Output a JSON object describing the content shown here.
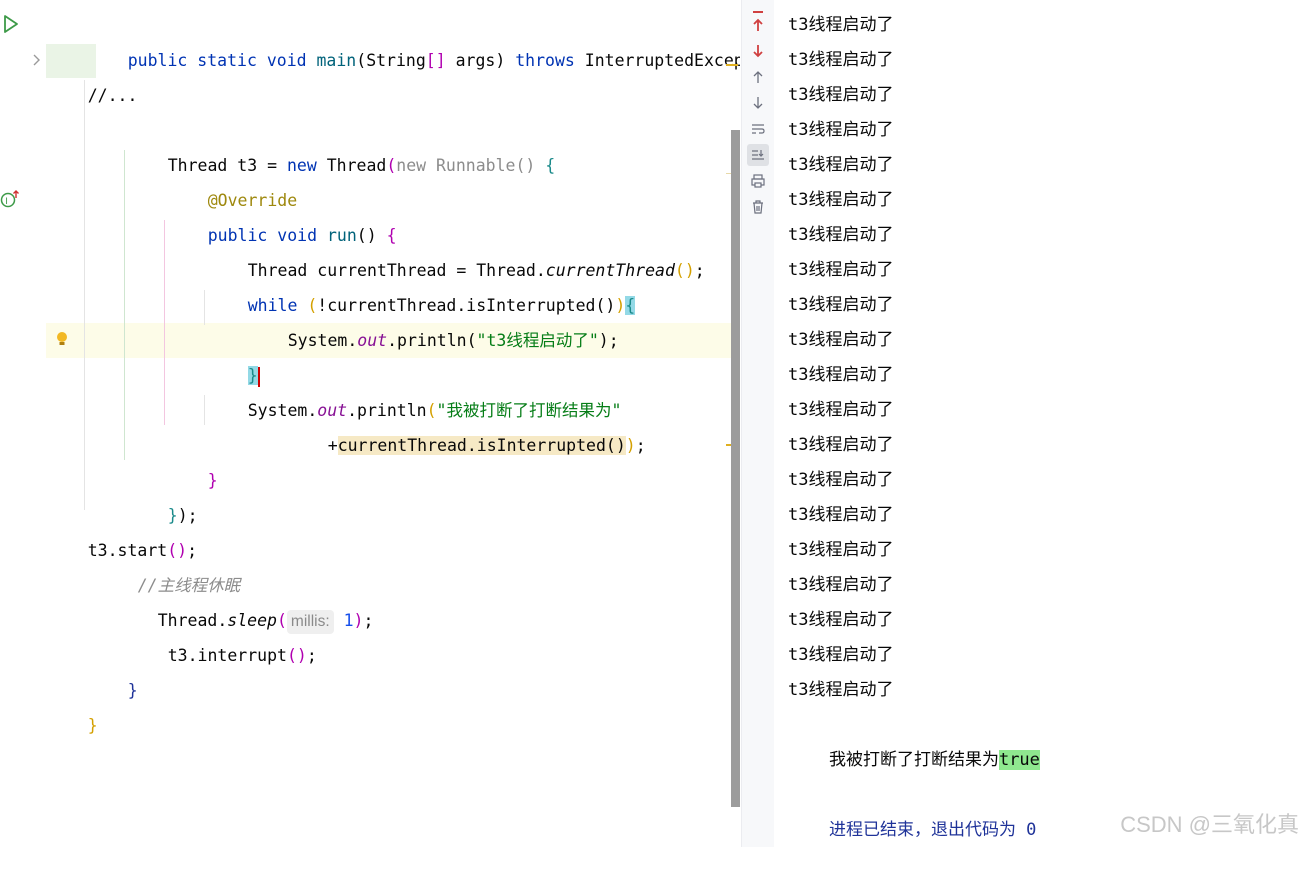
{
  "code": {
    "line1": {
      "kw1": "public static void ",
      "name": "main",
      "p_open": "(",
      "type": "String",
      "br": "[]",
      "args": " args",
      "p_close": ")",
      "throws": " throws ",
      "exc": "InterruptedExceptio"
    },
    "line2_fold": "//...",
    "line4": {
      "a": "Thread t3 = ",
      "new1": "new",
      "b": " Thread",
      "p_open": "(",
      "anon": "new Runnable() ",
      "brace": "{"
    },
    "line5": "@Override",
    "line6": {
      "kw": "public void ",
      "name": "run",
      "p": "() ",
      "brace": "{"
    },
    "line7": {
      "a": "Thread currentThread = Thread.",
      "method": "currentThread",
      "paren": "()",
      "semi": ";"
    },
    "line8": {
      "kw": "while ",
      "p_open": "(",
      "cond": "!currentThread.isInterrupted()",
      "p_close": ")",
      "brace": "{"
    },
    "line9": {
      "a": "System.",
      "out": "out",
      "b": ".println(",
      "str": "\"t3线程启动了\"",
      "c": ");"
    },
    "line10": "}",
    "line11": {
      "a": "System.",
      "out": "out",
      "b": ".println",
      "p_open": "(",
      "str": "\"我被打断了打断结果为\""
    },
    "line12": {
      "plus": "+",
      "expr": "currentThread.isInterrupted()",
      "p_close": ")",
      "semi": ";"
    },
    "line13": "}",
    "line14": {
      "a": "}",
      "b": ");"
    },
    "line15": {
      "a": "t3.start",
      "p": "()",
      "semi": ";"
    },
    "line16": "//主线程休眠",
    "line17": {
      "a": "Thread.",
      "method": "sleep",
      "p_open": "(",
      "hint": "millis:",
      "num": " 1",
      "p_close": ")",
      "semi": ";"
    },
    "line18": {
      "a": "t3.interrupt",
      "p": "()",
      "semi": ";"
    },
    "line19": "}",
    "line20": "}"
  },
  "console": {
    "lines": [
      "t3线程启动了",
      "t3线程启动了",
      "t3线程启动了",
      "t3线程启动了",
      "t3线程启动了",
      "t3线程启动了",
      "t3线程启动了",
      "t3线程启动了",
      "t3线程启动了",
      "t3线程启动了",
      "t3线程启动了",
      "t3线程启动了",
      "t3线程启动了",
      "t3线程启动了",
      "t3线程启动了",
      "t3线程启动了",
      "t3线程启动了",
      "t3线程启动了",
      "t3线程启动了",
      "t3线程启动了"
    ],
    "result_prefix": "我被打断了打断结果为",
    "result_value": "true",
    "exit_message": "进程已结束，退出代码为 0"
  },
  "watermark": "CSDN @三氧化真",
  "icons": {
    "run": "run-icon",
    "implements": "implements-icon",
    "bulb": "lightbulb-icon",
    "up_error": "prev-error-icon",
    "down_error": "next-error-icon",
    "up": "scroll-up-icon",
    "down": "scroll-down-icon",
    "wrap": "soft-wrap-icon",
    "scroll_end": "scroll-to-end-icon",
    "print": "print-icon",
    "trash": "clear-icon"
  }
}
